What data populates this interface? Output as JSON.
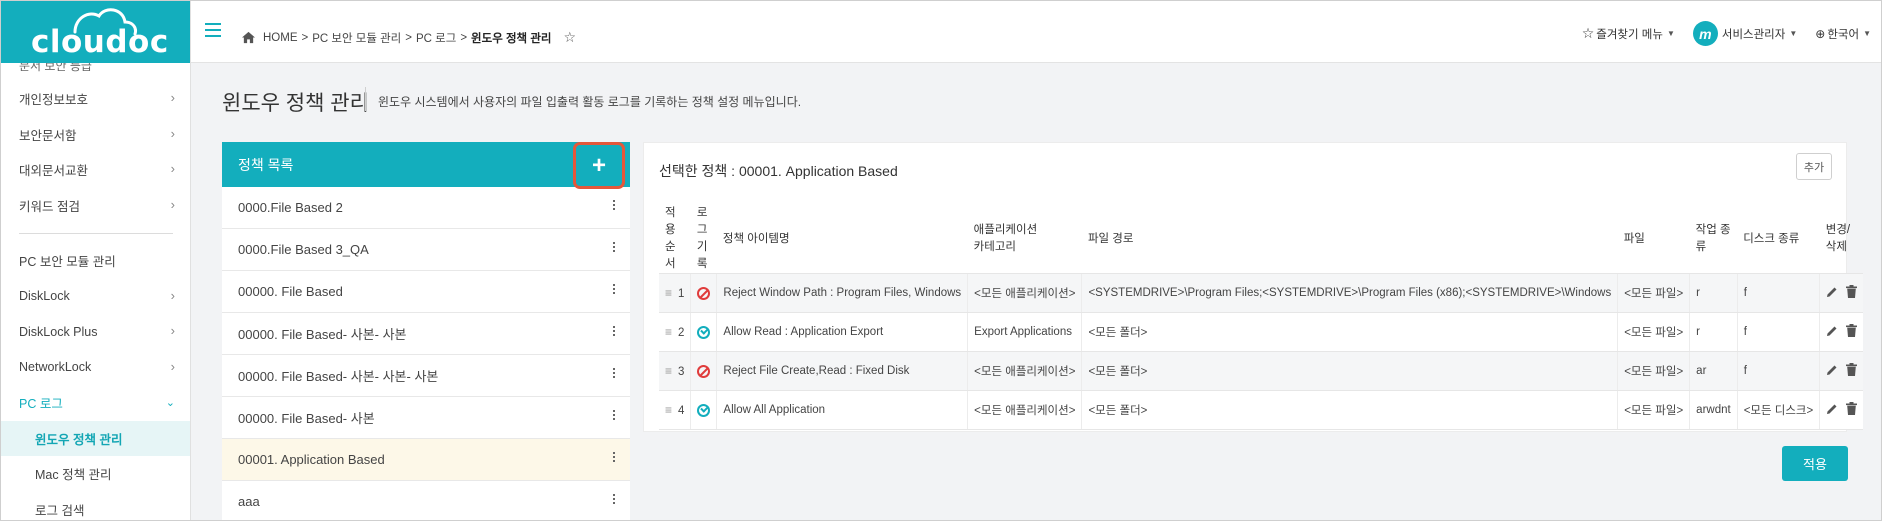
{
  "brand": {
    "logo_text": "cloudoc",
    "accent": "#13aebd"
  },
  "sidebar": {
    "cut_item": "문서 보안 등급",
    "items": [
      {
        "label": "개인정보보호"
      },
      {
        "label": "보안문서함"
      },
      {
        "label": "대외문서교환"
      },
      {
        "label": "키워드 점검"
      }
    ],
    "section_header": "PC 보안 모듈 관리",
    "modules": [
      {
        "label": "DiskLock"
      },
      {
        "label": "DiskLock Plus"
      },
      {
        "label": "NetworkLock"
      },
      {
        "label": "PC 로그"
      }
    ],
    "sub_items": [
      {
        "label": "윈도우 정책 관리"
      },
      {
        "label": "Mac 정책 관리"
      },
      {
        "label": "로그 검색"
      }
    ]
  },
  "topbar": {
    "breadcrumb": [
      "HOME",
      ">",
      "PC 보안 모듈 관리",
      ">",
      "PC 로그",
      ">"
    ],
    "breadcrumb_current": "윈도우 정책 관리",
    "favorites": "즐겨찾기 메뉴",
    "avatar_letter": "m",
    "user": "서비스관리자",
    "language": "한국어"
  },
  "page": {
    "title": "윈도우 정책 관리",
    "description": "윈도우 시스템에서 사용자의 파일 입출력 활동 로그를 기록하는 정책 설정 메뉴입니다."
  },
  "policy_list": {
    "header": "정책 목록",
    "add_symbol": "+",
    "items": [
      "0000.File Based 2",
      "0000.File Based 3_QA",
      "00000. File Based",
      "00000. File Based- 사본- 사본",
      "00000. File Based- 사본- 사본- 사본",
      "00000. File Based- 사본",
      "00001. Application Based",
      "aaa"
    ],
    "selected_index": 6
  },
  "detail": {
    "title": "선택한 정책 : 00001. Application Based",
    "add_button": "추가",
    "columns": {
      "order": "적용 순서",
      "log_line1": "로그",
      "log_line2": "기록",
      "item_name": "정책 아이템명",
      "category_line1": "애플리케이션",
      "category_line2": "카테고리",
      "path": "파일 경로",
      "file": "파일",
      "op": "작업 종류",
      "disk": "디스크 종류",
      "edit": "변경/삭제"
    },
    "rows": [
      {
        "order": "1",
        "log": "deny",
        "name": "Reject Window Path : Program Files, Windows",
        "category": "<모든 애플리케이션>",
        "path": "<SYSTEMDRIVE>\\Program Files;<SYSTEMDRIVE>\\Program Files (x86);<SYSTEMDRIVE>\\Windows",
        "file": "<모든 파일>",
        "op": "r",
        "disk": "f"
      },
      {
        "order": "2",
        "log": "allow",
        "name": "Allow Read : Application Export",
        "category": "Export Applications",
        "path": "<모든 폴더>",
        "file": "<모든 파일>",
        "op": "r",
        "disk": "f"
      },
      {
        "order": "3",
        "log": "deny",
        "name": "Reject File Create,Read : Fixed Disk",
        "category": "<모든 애플리케이션>",
        "path": "<모든 폴더>",
        "file": "<모든 파일>",
        "op": "ar",
        "disk": "f"
      },
      {
        "order": "4",
        "log": "allow",
        "name": "Allow All Application",
        "category": "<모든 애플리케이션>",
        "path": "<모든 폴더>",
        "file": "<모든 파일>",
        "op": "arwdnt",
        "disk": "<모든 디스크>"
      }
    ]
  },
  "apply_button": "적용"
}
